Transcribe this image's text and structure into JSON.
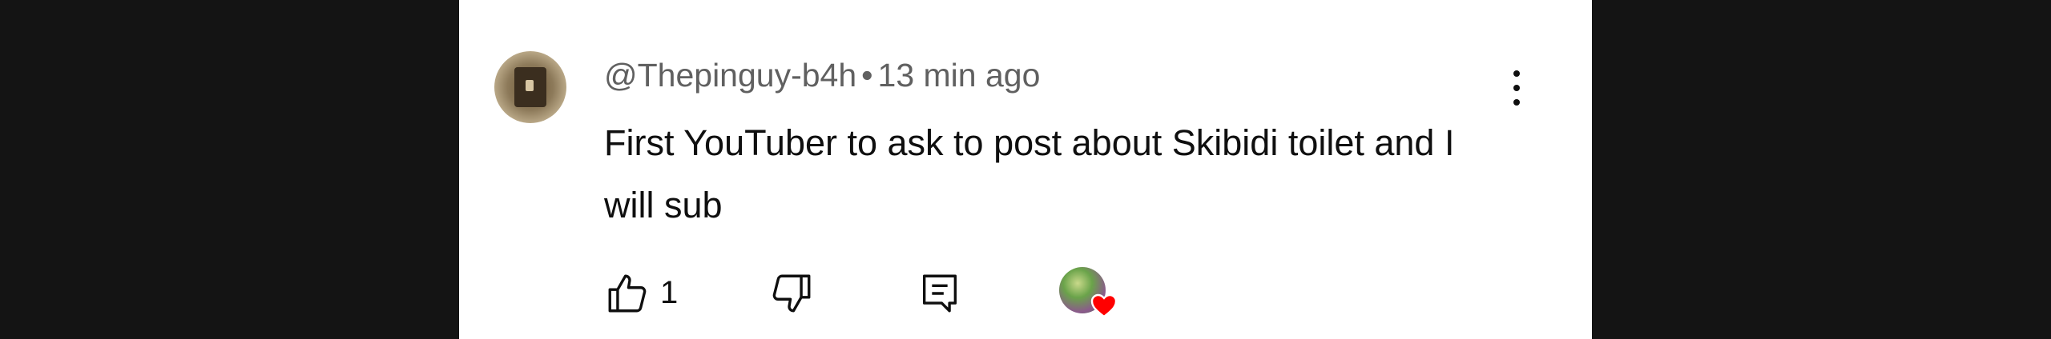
{
  "comment": {
    "author": "@Thepinguy-b4h",
    "separator": "•",
    "time": "13 min ago",
    "text": "First YouTuber to ask to post about Skibidi toilet and I will sub",
    "like_count": "1"
  },
  "icons": {
    "avatar": "user-avatar",
    "menu": "more-vert-icon",
    "like": "thumbs-up-icon",
    "dislike": "thumbs-down-icon",
    "reply": "reply-comment-icon",
    "hearted": "creator-heart-icon"
  },
  "colors": {
    "background": "#141414",
    "panel": "#ffffff",
    "meta_text": "#606060",
    "text": "#0f0f0f",
    "heart": "#ff0000"
  }
}
